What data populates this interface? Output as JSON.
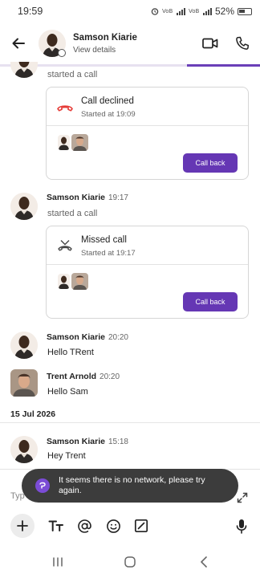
{
  "status_bar": {
    "time": "19:59",
    "network_1": "VoB LTE1",
    "network_2": "VoB LTE2",
    "battery": "52%"
  },
  "header": {
    "name": "Samson Kiarie",
    "subtitle": "View details"
  },
  "progress": {
    "fraction": 0.28
  },
  "messages": [
    {
      "text": "started a call"
    },
    {
      "call": {
        "title": "Call declined",
        "subtitle": "Started at 19:09",
        "button": "Call back"
      }
    },
    {
      "sender": "Samson Kiarie",
      "time": "19:17",
      "text": "started a call"
    },
    {
      "call": {
        "title": "Missed call",
        "subtitle": "Started at 19:17",
        "button": "Call back"
      }
    },
    {
      "sender": "Samson Kiarie",
      "time": "20:20",
      "text": "Hello TRent"
    },
    {
      "sender": "Trent Arnold",
      "time": "20:20",
      "text": "Hello Sam"
    },
    {
      "date_separator": "15 Jul 2026"
    },
    {
      "sender": "Samson Kiarie",
      "time": "15:18",
      "text": "Hey Trent"
    }
  ],
  "composer": {
    "placeholder": "Typ"
  },
  "toast": {
    "text": "It seems there is no network, please try again."
  },
  "colors": {
    "accent": "#6537b4",
    "declined": "#e53935",
    "toast_bg": "#3c3c3c"
  },
  "icons": [
    "back-arrow-icon",
    "video-call-icon",
    "phone-icon",
    "declined-call-icon",
    "missed-call-icon",
    "plus-icon",
    "text-format-icon",
    "mention-icon",
    "emoji-icon",
    "sketch-icon",
    "microphone-icon",
    "expand-icon",
    "recents-icon",
    "home-icon",
    "nav-back-icon"
  ]
}
